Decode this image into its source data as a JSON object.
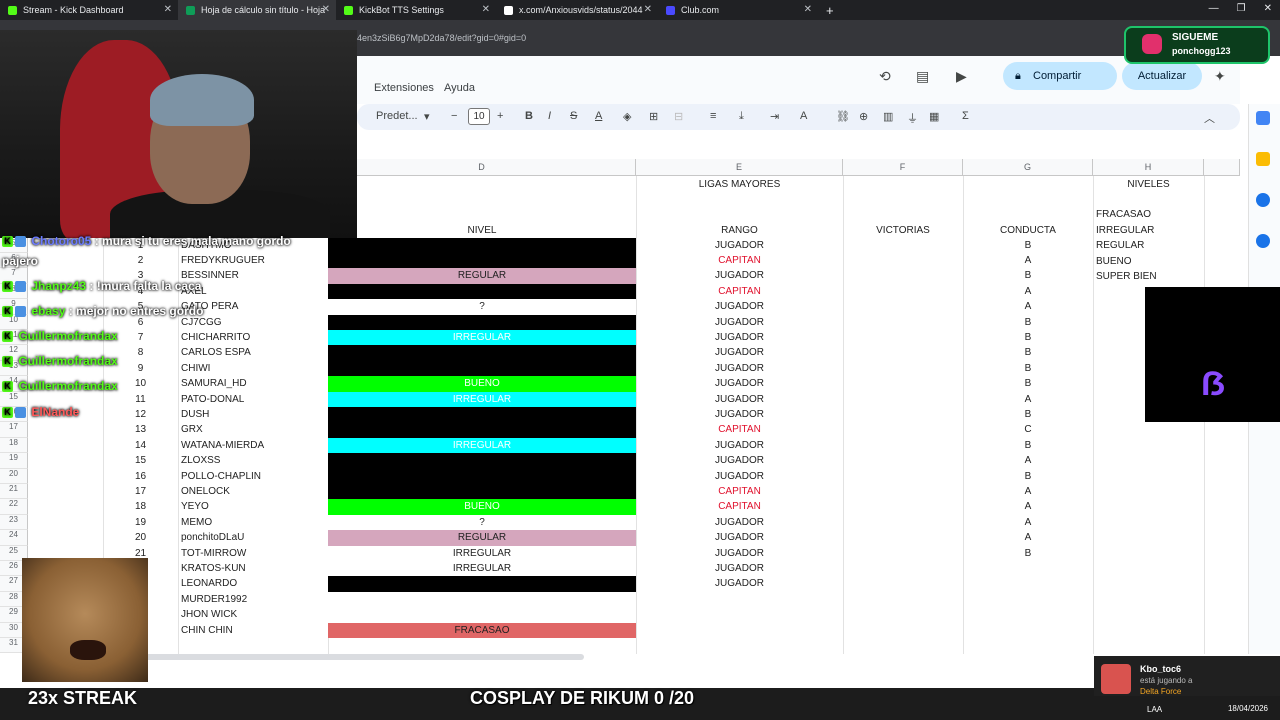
{
  "tabs": [
    {
      "label": "Stream - Kick Dashboard",
      "color": "#53fc18"
    },
    {
      "label": "Hoja de cálculo sin título - Hoja",
      "color": "#0f9d58"
    },
    {
      "label": "KickBot TTS Settings",
      "color": "#53fc18"
    },
    {
      "label": "x.com/Anxiousvids/status/2044",
      "color": "#ffffff"
    },
    {
      "label": "Club.com",
      "color": "#4a4aff"
    }
  ],
  "url": "4en3zSiB6g7MpD2da78/edit?gid=0#gid=0",
  "menu": {
    "extensiones": "Extensiones",
    "ayuda": "Ayuda"
  },
  "toolbar": {
    "font": "Predet...",
    "size": "10",
    "bold": "B",
    "italic": "I",
    "strike": "S",
    "textcolor": "A",
    "sum": "Σ"
  },
  "header": {
    "share": "Compartir",
    "update": "Actualizar"
  },
  "columns": {
    "D": "D",
    "E": "E",
    "F": "F",
    "G": "G",
    "H": "H"
  },
  "top": {
    "ligas": "LIGAS MAYORES",
    "niveles": "NIVELES"
  },
  "headers_row": {
    "nivel": "NIVEL",
    "rango": "RANGO",
    "victorias": "VICTORIAS",
    "conducta": "CONDUCTA"
  },
  "levels": [
    "FRACASAO",
    "IRREGULAR",
    "REGULAR",
    "BUENO",
    "SUPER BIEN"
  ],
  "rownums": [
    "1",
    "2",
    "3",
    "4",
    "5",
    "6",
    "7",
    "8",
    "9",
    "10",
    "11",
    "12",
    "13",
    "14",
    "15",
    "16",
    "17",
    "18",
    "19",
    "20",
    "21",
    "22",
    "23",
    "24",
    "25",
    "26",
    "27",
    "28",
    "29",
    "30",
    "31"
  ],
  "players": [
    {
      "n": "1",
      "name": "DASHYMO",
      "nivel": "",
      "nbg": "#000000",
      "rango": "JUGADOR",
      "cond": "B"
    },
    {
      "n": "2",
      "name": "FREDYKRUGUER",
      "nivel": "",
      "nbg": "#000000",
      "rango": "CAPITAN",
      "cond": "A"
    },
    {
      "n": "3",
      "name": "BESSINNER",
      "nivel": "REGULAR",
      "nbg": "#d5a6bd",
      "rango": "JUGADOR",
      "cond": "B"
    },
    {
      "n": "4",
      "name": "AXEL",
      "nivel": "",
      "nbg": "#000000",
      "rango": "CAPITAN",
      "cond": "A"
    },
    {
      "n": "5",
      "name": "GATO PERA",
      "nivel": "?",
      "nbg": "#ffffff",
      "rango": "JUGADOR",
      "cond": "A"
    },
    {
      "n": "6",
      "name": "CJ7CGG",
      "nivel": "",
      "nbg": "#000000",
      "rango": "JUGADOR",
      "cond": "B"
    },
    {
      "n": "7",
      "name": "CHICHARRITO",
      "nivel": "IRREGULAR",
      "nbg": "#00ffff",
      "rango": "JUGADOR",
      "cond": "B"
    },
    {
      "n": "8",
      "name": "CARLOS ESPA",
      "nivel": "",
      "nbg": "#000000",
      "rango": "JUGADOR",
      "cond": "B"
    },
    {
      "n": "9",
      "name": "CHIWI",
      "nivel": "",
      "nbg": "#000000",
      "rango": "JUGADOR",
      "cond": "B"
    },
    {
      "n": "10",
      "name": "SAMURAI_HD",
      "nivel": "BUENO",
      "nbg": "#00ff00",
      "rango": "JUGADOR",
      "cond": "B"
    },
    {
      "n": "11",
      "name": "PATO-DONAL",
      "nivel": "IRREGULAR",
      "nbg": "#00ffff",
      "rango": "JUGADOR",
      "cond": "A"
    },
    {
      "n": "12",
      "name": "DUSH",
      "nivel": "",
      "nbg": "#000000",
      "rango": "JUGADOR",
      "cond": "B"
    },
    {
      "n": "13",
      "name": "GRX",
      "nivel": "",
      "nbg": "#000000",
      "rango": "CAPITAN",
      "cond": "C"
    },
    {
      "n": "14",
      "name": "WATANA-MIERDA",
      "nivel": "IRREGULAR",
      "nbg": "#00ffff",
      "rango": "JUGADOR",
      "cond": "B"
    },
    {
      "n": "15",
      "name": "ZLOXSS",
      "nivel": "",
      "nbg": "#000000",
      "rango": "JUGADOR",
      "cond": "A"
    },
    {
      "n": "16",
      "name": "POLLO-CHAPLIN",
      "nivel": "",
      "nbg": "#000000",
      "rango": "JUGADOR",
      "cond": "B"
    },
    {
      "n": "17",
      "name": "ONELOCK",
      "nivel": "",
      "nbg": "#000000",
      "rango": "CAPITAN",
      "cond": "A"
    },
    {
      "n": "18",
      "name": "YEYO",
      "nivel": "BUENO",
      "nbg": "#00ff00",
      "rango": "CAPITAN",
      "cond": "A"
    },
    {
      "n": "19",
      "name": "MEMO",
      "nivel": "?",
      "nbg": "#ffffff",
      "rango": "JUGADOR",
      "cond": "A"
    },
    {
      "n": "20",
      "name": "ponchitoDLaU",
      "nivel": "REGULAR",
      "nbg": "#d5a6bd",
      "rango": "JUGADOR",
      "cond": "A"
    },
    {
      "n": "21",
      "name": "TOT-MIRROW",
      "nivel": "IRREGULAR",
      "nbg": "#ffffff",
      "rango": "JUGADOR",
      "cond": "B"
    },
    {
      "n": "",
      "name": "KRATOS-KUN",
      "nivel": "IRREGULAR",
      "nbg": "#ffffff",
      "rango": "JUGADOR",
      "cond": ""
    },
    {
      "n": "",
      "name": "LEONARDO",
      "nivel": "",
      "nbg": "#000000",
      "rango": "JUGADOR",
      "cond": ""
    },
    {
      "n": "",
      "name": "MURDER1992",
      "nivel": "",
      "nbg": "#ffffff",
      "rango": "",
      "cond": ""
    },
    {
      "n": "",
      "name": "JHON WICK",
      "nivel": "",
      "nbg": "#ffffff",
      "rango": "",
      "cond": ""
    },
    {
      "n": "",
      "name": "CHIN CHIN",
      "nivel": "FRACASAO",
      "nbg": "#e06666",
      "rango": "",
      "cond": ""
    }
  ],
  "chat": [
    {
      "user": "Chotoro05",
      "msg": ": mura si tu eres mala mano gordo",
      "ucolor": "#6b7bff"
    },
    {
      "user": "",
      "msg": "pajero",
      "ucolor": "#ffffff"
    },
    {
      "user": "Jhanpz43",
      "msg": ": !mura falta la caca",
      "ucolor": "#53fc18"
    },
    {
      "user": "ebasy",
      "msg": ": mejor no entres gordo",
      "ucolor": "#53fc18"
    },
    {
      "user": "Guillermofrandax",
      "msg": "",
      "ucolor": "#53fc18"
    },
    {
      "user": "Guillermofrandax",
      "msg": "",
      "ucolor": "#53fc18"
    },
    {
      "user": "Guillermofrandax",
      "msg": "",
      "ucolor": "#53fc18"
    },
    {
      "user": "ElNande",
      "msg": "",
      "ucolor": "#ff5a5a"
    }
  ],
  "overlay": {
    "follow": "SIGUEME",
    "handle": "ponchogg123",
    "streak": "23x STREAK",
    "cosplay": "COSPLAY DE RIKUM 0 /20"
  },
  "notification": {
    "name": "Kbo_toc6",
    "status": "está jugando a",
    "game": "Delta Force"
  },
  "taskbar": {
    "lang": "LAA",
    "date": "18/04/2026"
  }
}
